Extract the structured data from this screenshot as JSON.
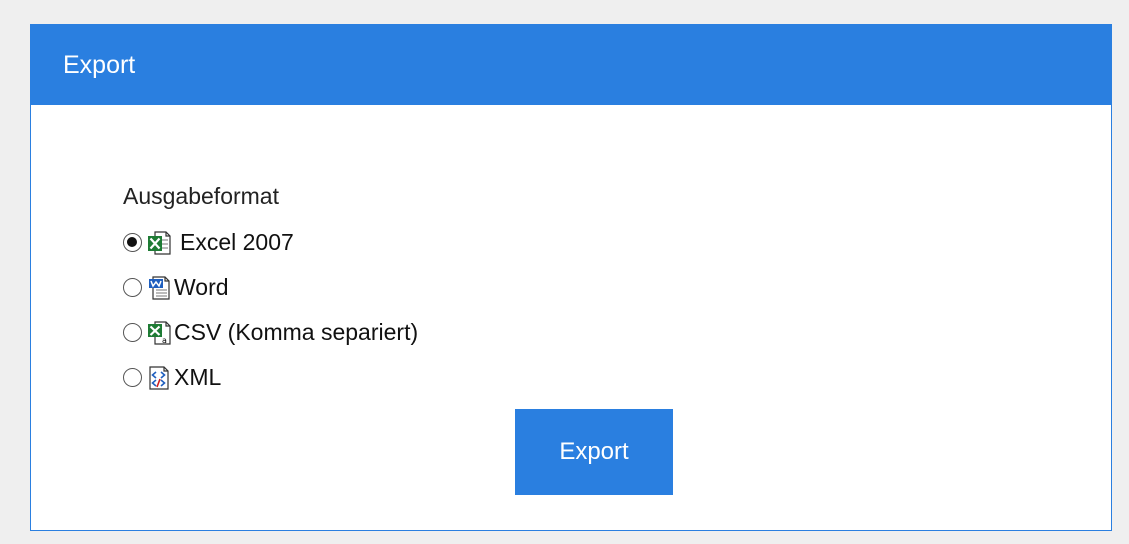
{
  "panel": {
    "title": "Export"
  },
  "format": {
    "label": "Ausgabeformat",
    "selected": "excel2007",
    "options": [
      {
        "id": "excel2007",
        "label": "Excel 2007",
        "icon": "excel-file-icon",
        "checked": true
      },
      {
        "id": "word",
        "label": "Word",
        "icon": "word-file-icon",
        "checked": false
      },
      {
        "id": "csv",
        "label": "CSV (Komma separiert)",
        "icon": "csv-file-icon",
        "checked": false
      },
      {
        "id": "xml",
        "label": "XML",
        "icon": "xml-file-icon",
        "checked": false
      }
    ]
  },
  "actions": {
    "export_label": "Export"
  },
  "colors": {
    "accent": "#2a7fe0",
    "background": "#efefef",
    "panel": "#ffffff"
  }
}
